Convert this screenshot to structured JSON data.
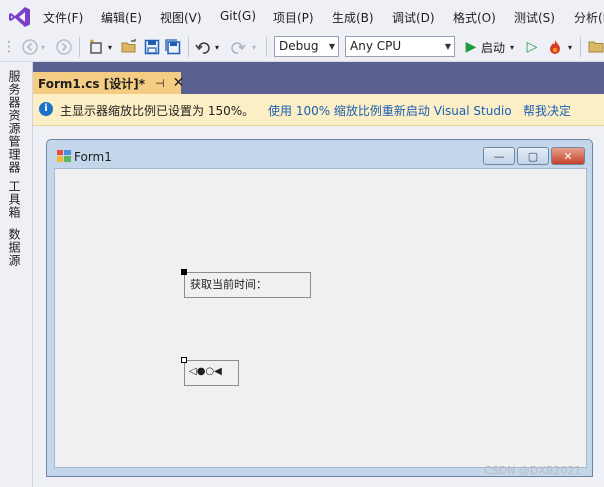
{
  "menu": {
    "items": [
      "文件(F)",
      "编辑(E)",
      "视图(V)",
      "Git(G)",
      "项目(P)",
      "生成(B)",
      "调试(D)",
      "格式(O)",
      "测试(S)",
      "分析(N)"
    ]
  },
  "toolbar": {
    "config_value": "Debug",
    "platform_value": "Any CPU",
    "start_label": "启动"
  },
  "left_panel": {
    "tabs": [
      "服务器资源管理器",
      "工具箱",
      "数据源"
    ]
  },
  "document_tab": {
    "title": "Form1.cs [设计]*",
    "pin_glyph": "⊣",
    "close_glyph": "✕"
  },
  "info_bar": {
    "icon_glyph": "i",
    "message": "主显示器缩放比例已设置为 150%。",
    "link_restart": "使用 100% 缩放比例重新启动 Visual Studio",
    "link_help": "帮我决定"
  },
  "form": {
    "title": "Form1",
    "minimize_glyph": "—",
    "maximize_glyph": "▢",
    "close_glyph": "✕"
  },
  "controls": {
    "label1_text": "获取当前时间：",
    "label2_text": "◁●○◀"
  },
  "watermark": "CSDN @DXB2021",
  "colors": {
    "doc_tab_active": "#f5cc84",
    "tabstrip_bg": "#5a6190",
    "info_bar_bg": "#fcefc5",
    "link": "#1a5fb4"
  }
}
